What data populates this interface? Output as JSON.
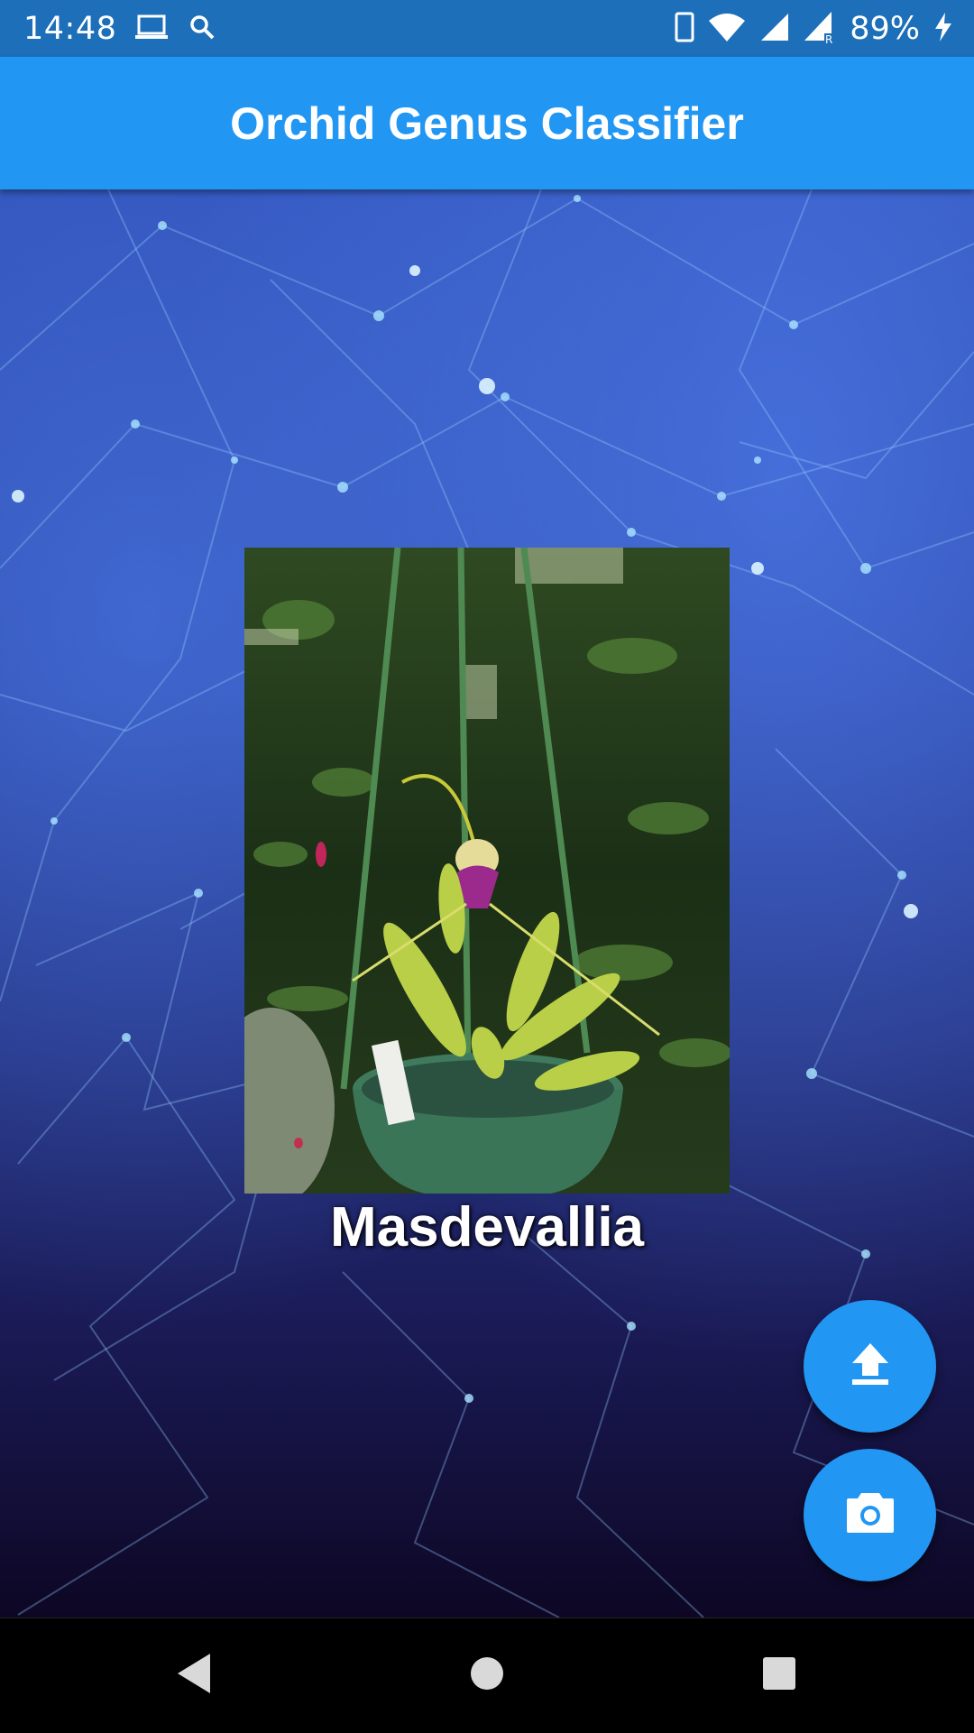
{
  "status_bar": {
    "time": "14:48",
    "battery": "89%",
    "left_icons": [
      "laptop-icon",
      "search-icon"
    ],
    "right_icons": [
      "phone-icon",
      "wifi-icon",
      "signal-icon",
      "signal-roaming-icon",
      "charging-icon"
    ]
  },
  "app_bar": {
    "title": "Orchid Genus Classifier"
  },
  "main": {
    "image_description": "orchid-photo",
    "prediction": "Masdevallia"
  },
  "fabs": [
    {
      "name": "upload-button",
      "icon": "upload-icon"
    },
    {
      "name": "camera-button",
      "icon": "camera-icon"
    }
  ],
  "nav_bar": {
    "buttons": [
      "back",
      "home",
      "recents"
    ]
  },
  "colors": {
    "status_bar": "#1c6fb8",
    "app_bar": "#2196f3",
    "fab": "#2196f3",
    "nav_bar": "#000000"
  }
}
